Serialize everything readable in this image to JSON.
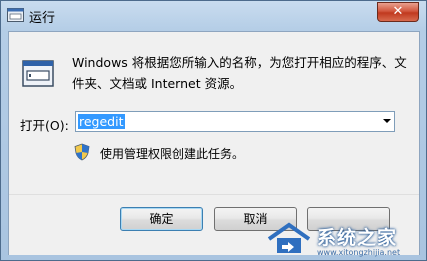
{
  "window": {
    "title": "运行",
    "close_symbol": "✕"
  },
  "dialog": {
    "description": "Windows 将根据您所输入的名称，为您打开相应的程序、文件夹、文档或 Internet 资源。",
    "open_label": "打开(O):",
    "open_value": "regedit",
    "admin_note": "使用管理权限创建此任务。"
  },
  "buttons": {
    "ok": "确定",
    "cancel": "取消",
    "browse": ""
  },
  "watermark": {
    "text": "系统之家",
    "url": "www.xitongzhijia.net"
  },
  "icons": {
    "app": "run-icon",
    "shield": "uac-shield-icon",
    "dropdown": "chevron-down-icon"
  },
  "colors": {
    "selection": "#3399ff",
    "close": "#c0391e",
    "frame": "#b4cde6"
  }
}
